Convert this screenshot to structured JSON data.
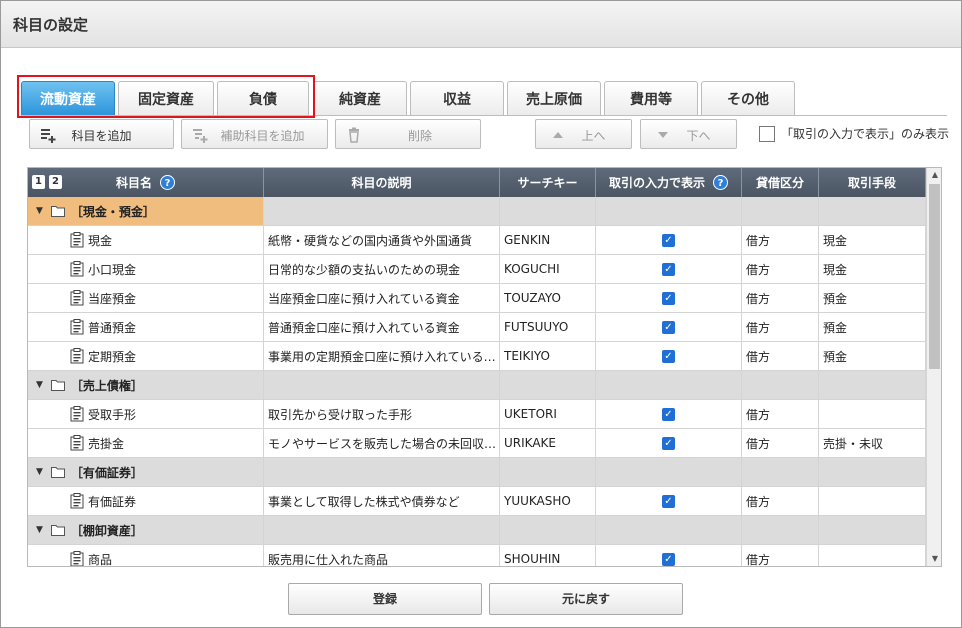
{
  "window": {
    "title": "科目の設定"
  },
  "tabs": [
    {
      "label": "流動資産",
      "active": true
    },
    {
      "label": "固定資産"
    },
    {
      "label": "負債"
    },
    {
      "label": "純資産"
    },
    {
      "label": "収益"
    },
    {
      "label": "売上原価"
    },
    {
      "label": "費用等"
    },
    {
      "label": "その他"
    }
  ],
  "toolbar": {
    "add_account": "科目を追加",
    "add_sub_account": "補助科目を追加",
    "delete": "削除",
    "up": "上へ",
    "down": "下へ",
    "show_only_filter": "「取引の入力で表示」のみ表示"
  },
  "grid": {
    "level_buttons": [
      "1",
      "2"
    ],
    "columns": [
      "科目名",
      "科目の説明",
      "サーチキー",
      "取引の入力で表示",
      "貸借区分",
      "取引手段"
    ],
    "help_glyph": "?",
    "rows": [
      {
        "type": "group",
        "name": "［現金・預金］"
      },
      {
        "type": "item",
        "name": "現金",
        "desc": "紙幣・硬貨などの国内通貨や外国通貨",
        "key": "GENKIN",
        "show": true,
        "dc": "借方",
        "method": "現金"
      },
      {
        "type": "item",
        "name": "小口現金",
        "desc": "日常的な少額の支払いのための現金",
        "key": "KOGUCHI",
        "show": true,
        "dc": "借方",
        "method": "現金"
      },
      {
        "type": "item",
        "name": "当座預金",
        "desc": "当座預金口座に預け入れている資金",
        "key": "TOUZAYO",
        "show": true,
        "dc": "借方",
        "method": "預金"
      },
      {
        "type": "item",
        "name": "普通預金",
        "desc": "普通預金口座に預け入れている資金",
        "key": "FUTSUUYO",
        "show": true,
        "dc": "借方",
        "method": "預金"
      },
      {
        "type": "item",
        "name": "定期預金",
        "desc": "事業用の定期預金口座に預け入れている…",
        "key": "TEIKIYO",
        "show": true,
        "dc": "借方",
        "method": "預金"
      },
      {
        "type": "group",
        "name": "［売上債権］"
      },
      {
        "type": "item",
        "name": "受取手形",
        "desc": "取引先から受け取った手形",
        "key": "UKETORI",
        "show": true,
        "dc": "借方",
        "method": ""
      },
      {
        "type": "item",
        "name": "売掛金",
        "desc": "モノやサービスを販売した場合の未回収…",
        "key": "URIKAKE",
        "show": true,
        "dc": "借方",
        "method": "売掛・未収"
      },
      {
        "type": "group",
        "name": "［有価証券］"
      },
      {
        "type": "item",
        "name": "有価証券",
        "desc": "事業として取得した株式や債券など",
        "key": "YUUKASHO",
        "show": true,
        "dc": "借方",
        "method": ""
      },
      {
        "type": "group",
        "name": "［棚卸資産］"
      },
      {
        "type": "item",
        "name": "商品",
        "desc": "販売用に仕入れた商品",
        "key": "SHOUHIN",
        "show": true,
        "dc": "借方",
        "method": ""
      }
    ]
  },
  "footer": {
    "register": "登録",
    "revert": "元に戻す"
  },
  "colors": {
    "active_tab": "#2d95db",
    "highlight_border": "#e0141a",
    "header_bg": "#555f6d",
    "selected_group": "#f1bd7e"
  }
}
